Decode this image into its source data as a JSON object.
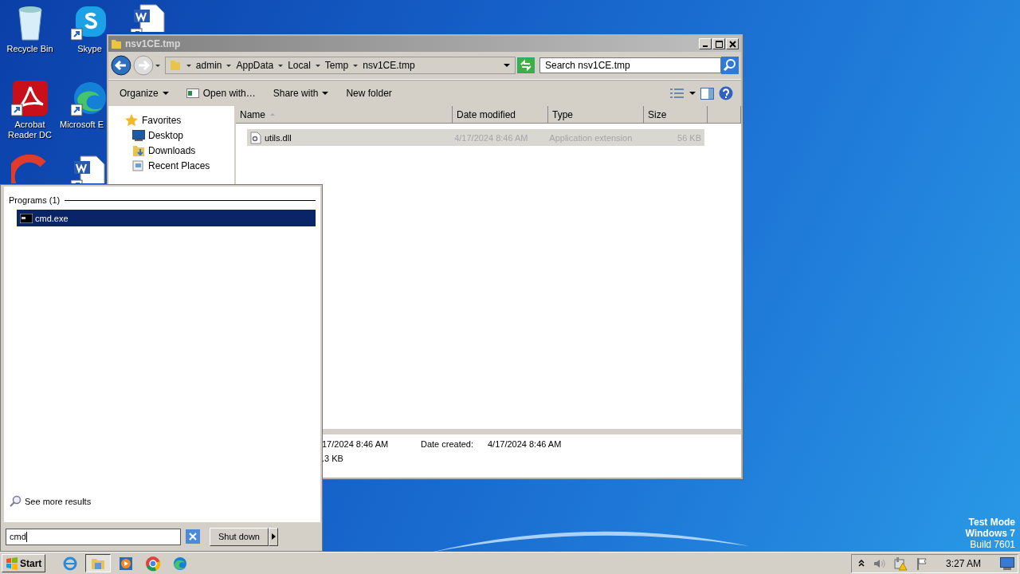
{
  "desktop": {
    "icon_rows": [
      [
        {
          "kind": "recycle",
          "label": "Recycle Bin"
        },
        {
          "kind": "skype",
          "label": "Skype"
        },
        {
          "kind": "word"
        }
      ],
      [
        {
          "kind": "acrobat",
          "label": "Acrobat Reader DC"
        },
        {
          "kind": "edge",
          "label": "Microsoft E"
        }
      ],
      [
        {
          "kind": "ccleaner"
        },
        {
          "kind": "word"
        }
      ]
    ],
    "notice": [
      "Test Mode",
      "Windows 7",
      "Build 7601"
    ]
  },
  "explorer": {
    "title": "nsv1CE.tmp",
    "breadcrumb": [
      "admin",
      "AppData",
      "Local",
      "Temp",
      "nsv1CE.tmp"
    ],
    "search": {
      "placeholder": "Search nsv1CE.tmp"
    },
    "toolbar": [
      {
        "label": "Organize",
        "kind": "menu"
      },
      {
        "label": "Open with…",
        "kind": "open"
      },
      {
        "label": "Share with",
        "kind": "menu"
      },
      {
        "label": "New folder",
        "kind": "plain"
      }
    ],
    "nav": [
      {
        "label": "Favorites",
        "kind": "star",
        "children": [
          {
            "label": "Desktop",
            "kind": "desktop"
          },
          {
            "label": "Downloads",
            "kind": "downloads"
          },
          {
            "label": "Recent Places",
            "kind": "recent"
          }
        ]
      }
    ],
    "columns": [
      {
        "label": "Name",
        "sorted": true
      },
      {
        "label": "Date modified",
        "sorted": false
      },
      {
        "label": "Type",
        "sorted": false
      },
      {
        "label": "Size",
        "sorted": false
      }
    ],
    "rows": [
      {
        "name": "utils.dll",
        "date": "4/17/2024 8:46 AM",
        "type": "Application extension",
        "size": "56 KB",
        "selected": true
      }
    ],
    "details": {
      "modified_value": "17/2024 8:46 AM",
      "created_label": "Date created:",
      "created_value": "4/17/2024 8:46 AM",
      "size_value": ".3 KB"
    }
  },
  "start_menu": {
    "group": "Programs (1)",
    "results": [
      {
        "label": "cmd.exe",
        "selected": true
      }
    ],
    "more": "See more results",
    "search_value": "cmd",
    "shutdown": "Shut down"
  },
  "taskbar": {
    "start": "Start",
    "apps": [
      {
        "kind": "ie",
        "active": false
      },
      {
        "kind": "explorer",
        "active": true
      },
      {
        "kind": "media",
        "active": false
      },
      {
        "kind": "chrome",
        "active": false
      },
      {
        "kind": "edge",
        "active": false
      }
    ],
    "time": "3:27 AM"
  }
}
